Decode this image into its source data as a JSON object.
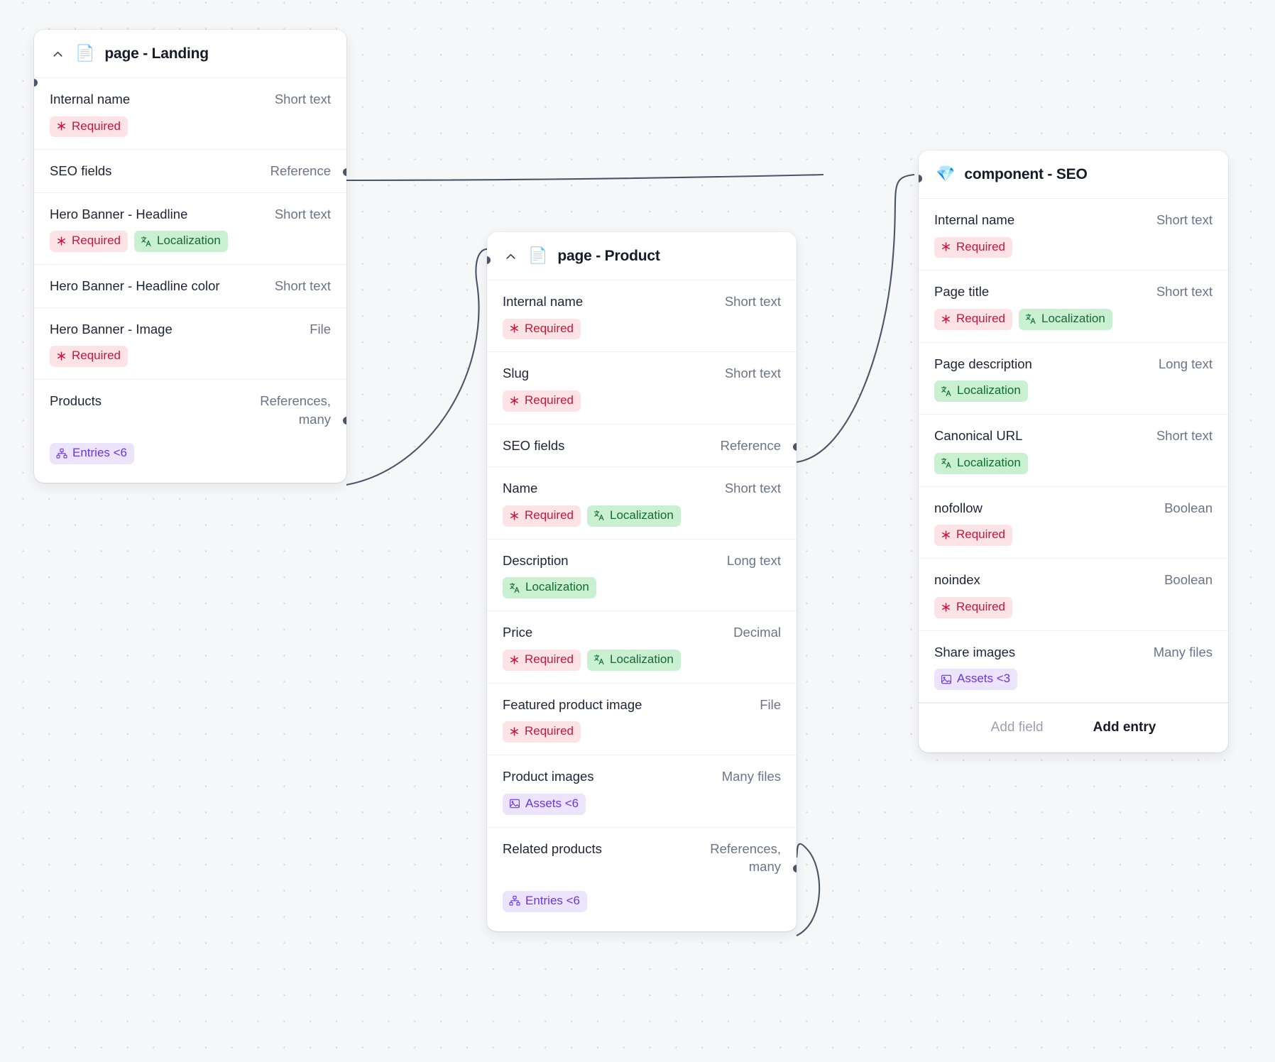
{
  "canvas": {
    "background": "#f6f7f9",
    "grid_dot_color": "#cfd4dc",
    "edge_color": "#4a5568"
  },
  "badge_types": {
    "required": {
      "label": "Required",
      "icon": "asterisk-icon",
      "bg": "#fde3e6",
      "fg": "#c4183c"
    },
    "localization": {
      "label": "Localization",
      "icon": "translate-icon",
      "bg": "#c9f0d1",
      "fg": "#136b30"
    },
    "entries": {
      "icon": "entries-icon",
      "bg": "#ece4fd",
      "fg": "#6c35de"
    },
    "assets": {
      "icon": "image-icon",
      "bg": "#ece4fd",
      "fg": "#6c35de"
    }
  },
  "nodes": [
    {
      "id": "page-landing",
      "emoji": "📄",
      "emoji_name": "page-document-emoji",
      "title": "page - Landing",
      "collapsible": true,
      "fields": [
        {
          "name": "Internal name",
          "type": "Short text",
          "badges": [
            "Required"
          ]
        },
        {
          "name": "SEO fields",
          "type": "Reference",
          "badges": []
        },
        {
          "name": "Hero Banner - Headline",
          "type": "Short text",
          "badges": [
            "Required",
            "Localization"
          ]
        },
        {
          "name": "Hero Banner - Headline color",
          "type": "Short text",
          "badges": []
        },
        {
          "name": "Hero Banner - Image",
          "type": "File",
          "badges": [
            "Required"
          ]
        },
        {
          "name": "Products",
          "type": "References, many",
          "badges": [
            "Entries <6"
          ]
        }
      ]
    },
    {
      "id": "page-product",
      "emoji": "📄",
      "emoji_name": "page-document-emoji",
      "title": "page - Product",
      "collapsible": true,
      "fields": [
        {
          "name": "Internal name",
          "type": "Short text",
          "badges": [
            "Required"
          ]
        },
        {
          "name": "Slug",
          "type": "Short text",
          "badges": [
            "Required"
          ]
        },
        {
          "name": "SEO fields",
          "type": "Reference",
          "badges": []
        },
        {
          "name": "Name",
          "type": "Short text",
          "badges": [
            "Required",
            "Localization"
          ]
        },
        {
          "name": "Description",
          "type": "Long text",
          "badges": [
            "Localization"
          ]
        },
        {
          "name": "Price",
          "type": "Decimal",
          "badges": [
            "Required",
            "Localization"
          ]
        },
        {
          "name": "Featured product image",
          "type": "File",
          "badges": [
            "Required"
          ]
        },
        {
          "name": "Product images",
          "type": "Many files",
          "badges": [
            "Assets <6"
          ]
        },
        {
          "name": "Related products",
          "type": "References, many",
          "badges": [
            "Entries <6"
          ]
        }
      ]
    },
    {
      "id": "component-seo",
      "emoji": "💎",
      "emoji_name": "diamond-emoji",
      "title": "component - SEO",
      "collapsible": false,
      "fields": [
        {
          "name": "Internal name",
          "type": "Short text",
          "badges": [
            "Required"
          ]
        },
        {
          "name": "Page title",
          "type": "Short text",
          "badges": [
            "Required",
            "Localization"
          ]
        },
        {
          "name": "Page description",
          "type": "Long text",
          "badges": [
            "Localization"
          ]
        },
        {
          "name": "Canonical URL",
          "type": "Short text",
          "badges": [
            "Localization"
          ]
        },
        {
          "name": "nofollow",
          "type": "Boolean",
          "badges": [
            "Required"
          ]
        },
        {
          "name": "noindex",
          "type": "Boolean",
          "badges": [
            "Required"
          ]
        },
        {
          "name": "Share images",
          "type": "Many files",
          "badges": [
            "Assets <3"
          ]
        }
      ],
      "footer": {
        "add_field_label": "Add field",
        "add_entry_label": "Add entry"
      }
    }
  ]
}
